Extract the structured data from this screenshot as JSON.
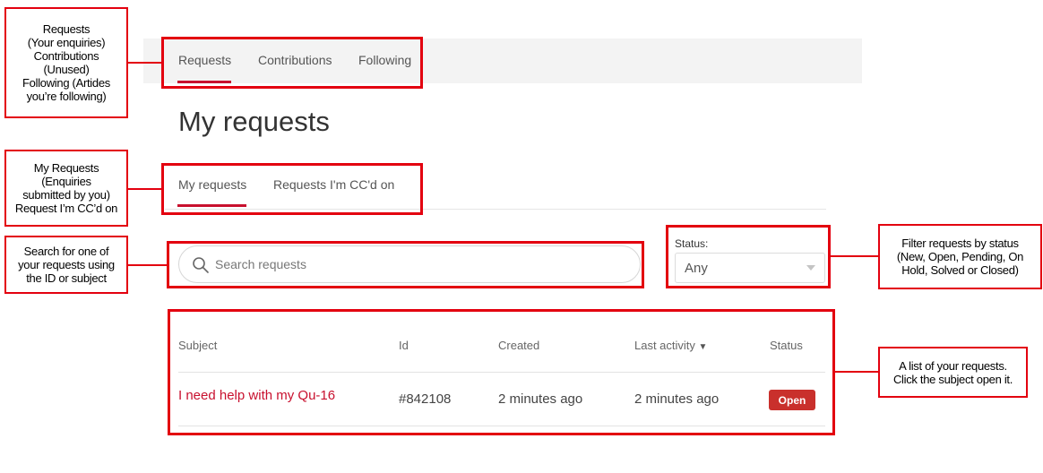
{
  "nav": {
    "items": [
      {
        "label": "Requests"
      },
      {
        "label": "Contributions"
      },
      {
        "label": "Following"
      }
    ]
  },
  "page": {
    "title": "My requests"
  },
  "tabs": [
    {
      "label": "My requests"
    },
    {
      "label": "Requests I'm CC'd on"
    }
  ],
  "search": {
    "placeholder": "Search requests",
    "value": ""
  },
  "filter": {
    "label": "Status:",
    "selected": "Any"
  },
  "table": {
    "columns": [
      "Subject",
      "Id",
      "Created",
      "Last activity",
      "Status"
    ],
    "sort_indicator": "▼",
    "rows": [
      {
        "subject": "I need help with my Qu-16",
        "id": "#842108",
        "created": "2 minutes ago",
        "last_activity": "2 minutes ago",
        "status": "Open"
      }
    ]
  },
  "annotations": {
    "nav": [
      "Requests",
      "(Your enquiries)",
      "Contributions",
      "(Unused)",
      "Following (Artides",
      "you’re following)"
    ],
    "tabs": [
      "My Requests",
      "(Enquiries",
      "submitted by you)",
      "Request I’m CC’d on"
    ],
    "search": [
      "Search for one of",
      "your requests using",
      "the ID or subject"
    ],
    "filter": [
      "Filter requests by status",
      "(New, Open, Pending, On",
      "Hold, Solved or Closed)"
    ],
    "table": [
      "A list of your requests.",
      "Click the subject open it."
    ]
  },
  "colors": {
    "annotation": "#e3000f",
    "accent": "#c8102e",
    "status_open": "#c9302c"
  }
}
